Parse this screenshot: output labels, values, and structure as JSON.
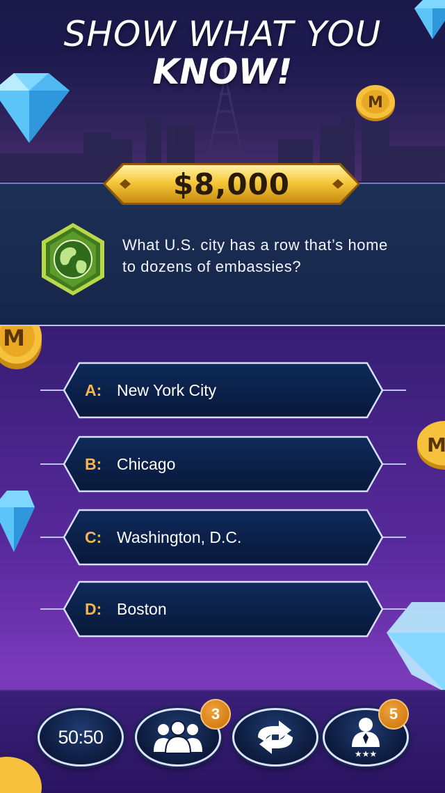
{
  "headline": {
    "line1": "SHOW WHAT YOU",
    "line2": "KNOW!"
  },
  "prize": {
    "amount": "$8,000"
  },
  "question": {
    "icon": "globe-icon",
    "text": "What U.S. city has a row that’s home to dozens of embassies?"
  },
  "answers": [
    {
      "letter": "A:",
      "text": "New York City"
    },
    {
      "letter": "B:",
      "text": "Chicago"
    },
    {
      "letter": "C:",
      "text": "Washington, D.C."
    },
    {
      "letter": "D:",
      "text": "Boston"
    }
  ],
  "lifelines": {
    "fifty_fifty": {
      "label": "50:50"
    },
    "ask_audience": {
      "icon": "audience-icon",
      "count": "3"
    },
    "switch_question": {
      "icon": "swap-arrows-icon"
    },
    "ask_expert": {
      "icon": "expert-icon",
      "count": "5"
    }
  },
  "colors": {
    "gold": "#f4b64a",
    "panel": "#1c2f55",
    "badge": "#e08a1e"
  }
}
